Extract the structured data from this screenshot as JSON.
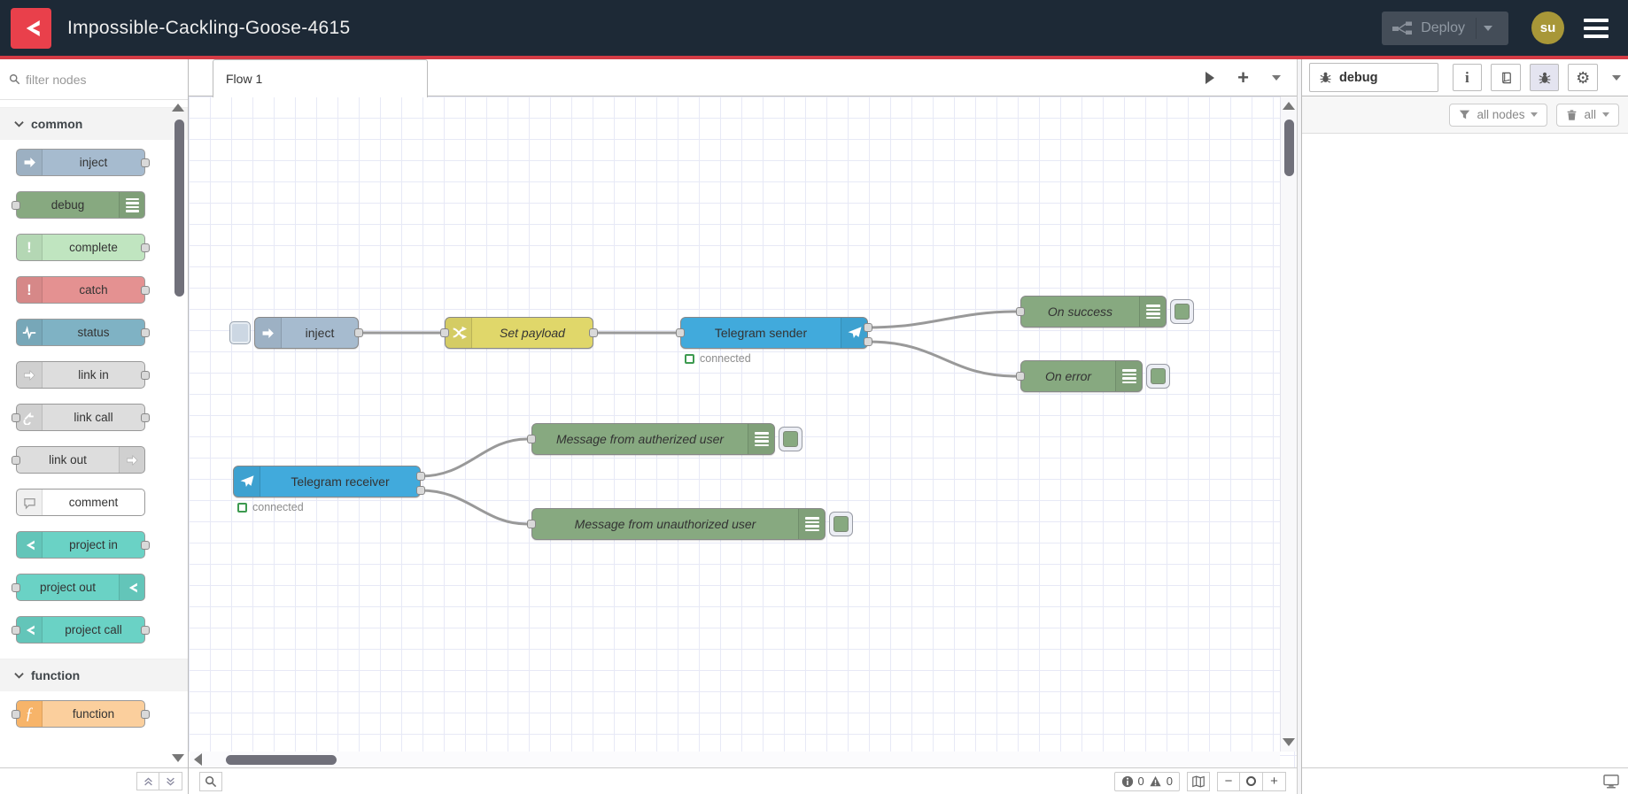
{
  "colors": {
    "header_bg": "#1d2936",
    "brand_red": "#e9404b",
    "accent_line": "#d53b45",
    "node_inject": "#a6bbcf",
    "node_debug": "#87a980",
    "node_complete": "#c0e5c0",
    "node_catch": "#e49191",
    "node_status": "#7fb2c4",
    "node_link": "#dddddd",
    "node_comment": "#ffffff",
    "node_project": "#6ad2c5",
    "node_function": "#fbcf9d",
    "node_change": "#e0d76a",
    "node_telegram": "#41aadc",
    "status_green": "#3d9a50",
    "wire": "#999999"
  },
  "header": {
    "title": "Impossible-Cackling-Goose-4615",
    "deploy_label": "Deploy",
    "avatar_initials": "su"
  },
  "palette": {
    "search_placeholder": "filter nodes",
    "categories": [
      {
        "label": "common",
        "items": [
          {
            "label": "inject"
          },
          {
            "label": "debug"
          },
          {
            "label": "complete"
          },
          {
            "label": "catch"
          },
          {
            "label": "status"
          },
          {
            "label": "link in"
          },
          {
            "label": "link call"
          },
          {
            "label": "link out"
          },
          {
            "label": "comment"
          },
          {
            "label": "project in"
          },
          {
            "label": "project out"
          },
          {
            "label": "project call"
          }
        ]
      },
      {
        "label": "function",
        "items": [
          {
            "label": "function"
          }
        ]
      }
    ]
  },
  "workspace": {
    "tab_label": "Flow 1",
    "nodes": [
      {
        "label": "inject"
      },
      {
        "label": "Set payload"
      },
      {
        "label": "Telegram sender",
        "status": "connected"
      },
      {
        "label": "On success"
      },
      {
        "label": "On error"
      },
      {
        "label": "Telegram receiver",
        "status": "connected"
      },
      {
        "label": "Message from autherized user"
      },
      {
        "label": "Message from unauthorized user"
      }
    ],
    "footer": {
      "errors": "0",
      "warnings": "0",
      "zoom_out": "−",
      "zoom_in": "+"
    }
  },
  "sidebar": {
    "tab_label": "debug",
    "filter_button": "all nodes",
    "clear_button": "all"
  }
}
